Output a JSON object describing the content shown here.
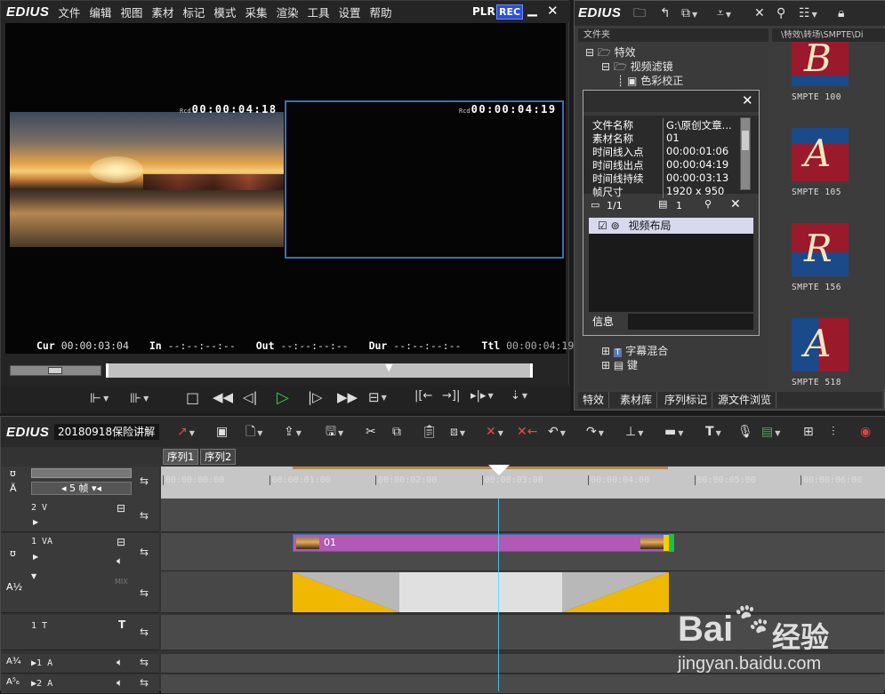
{
  "player": {
    "logo": "EDIUS",
    "menu": [
      "文件",
      "编辑",
      "视图",
      "素材",
      "标记",
      "模式",
      "采集",
      "渲染",
      "工具",
      "设置",
      "帮助"
    ],
    "plr": "PLR",
    "rec": "REC",
    "left_tc_prefix": "Rcd",
    "left_tc": "00:00:04:18",
    "right_tc_prefix": "Rcd",
    "right_tc": "00:00:04:19",
    "cur_label": "Cur",
    "cur_value": "00:00:03:04",
    "in_label": "In",
    "in_value": "--:--:--:--",
    "out_label": "Out",
    "out_value": "--:--:--:--",
    "dur_label": "Dur",
    "dur_value": "--:--:--:--",
    "ttl_label": "Ttl",
    "ttl_value": "00:00:04:19"
  },
  "bin": {
    "logo": "EDIUS",
    "tree_header": "文件夹",
    "path": "\\特效\\转场\\SMPTE\\Di",
    "tree": [
      {
        "label": "特效",
        "indent": 0
      },
      {
        "label": "视频滤镜",
        "indent": 1
      },
      {
        "label": "色彩校正",
        "indent": 2
      },
      {
        "label": "字幕混合",
        "indent": 1
      },
      {
        "label": "键",
        "indent": 1
      }
    ],
    "thumbs": [
      {
        "letter": "B",
        "label": "SMPTE  100"
      },
      {
        "letter": "A",
        "label": "SMPTE  105"
      },
      {
        "letter": "R",
        "label": "SMPTE  156"
      },
      {
        "letter": "A",
        "label": "SMPTE  518"
      }
    ],
    "tabs": [
      "特效",
      "素材库",
      "序列标记",
      "源文件浏览"
    ]
  },
  "info_dialog": {
    "rows": [
      {
        "k": "文件名称",
        "v": "G:\\原创文章..."
      },
      {
        "k": "素材名称",
        "v": "01"
      },
      {
        "k": "时间线入点",
        "v": "00:00:01:06"
      },
      {
        "k": "时间线出点",
        "v": "00:00:04:19"
      },
      {
        "k": "时间线持续",
        "v": "00:00:03:13"
      },
      {
        "k": "帧尺寸",
        "v": "1920 x 950"
      }
    ],
    "page": "1/1",
    "count": "1",
    "effect_item": "视频布局",
    "footer": "信息"
  },
  "timeline": {
    "logo": "EDIUS",
    "project": "20180918保险讲解",
    "seq_tabs": [
      "序列1",
      "序列2"
    ],
    "frames": "5 帧",
    "ruler": [
      "00:00:00:00",
      "00:00:01:00",
      "00:00:02:00",
      "00:00:03:00",
      "00:00:04:00",
      "00:00:05:00",
      "00:00:06:00"
    ],
    "tracks": {
      "v2": "2 V",
      "va1": "1 VA",
      "t1": "1 T",
      "a1": "1 A",
      "a2": "2 A",
      "mix": "MIX"
    },
    "clip_name": "01"
  },
  "watermark": {
    "brand": "Bai",
    "brand2": "经验",
    "url": "jingyan.baidu.com"
  },
  "colors": {
    "accent_blue": "#3d6fb4",
    "clip_purple": "#b259b5",
    "rec_blue": "#2a4fd8",
    "yellow": "#f0b800"
  }
}
